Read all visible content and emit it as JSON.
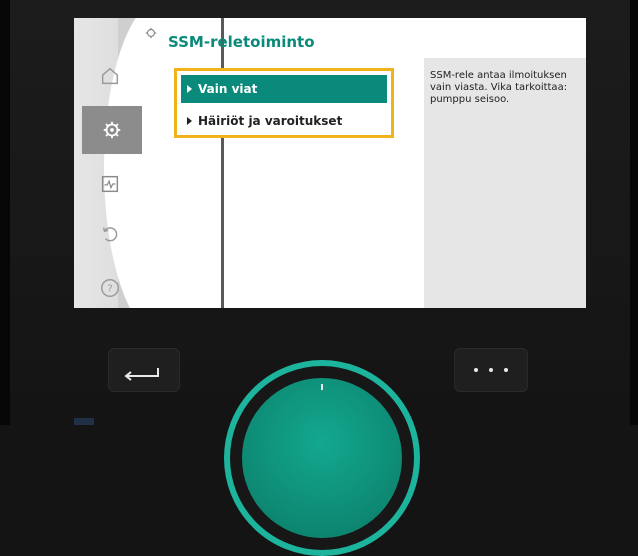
{
  "screen": {
    "title": "SSM-reletoiminto",
    "options": [
      {
        "label": "Vain viat",
        "selected": true
      },
      {
        "label": "Häiriöt ja varoitukset",
        "selected": false
      }
    ],
    "help_text": "SSM-rele antaa ilmoituksen vain viasta. Vika tarkoittaa: pumppu seisoo."
  },
  "sidebar": {
    "items": [
      {
        "icon": "home-icon",
        "active": false
      },
      {
        "icon": "gear-icon",
        "active": true
      },
      {
        "icon": "diagnostics-icon",
        "active": false
      },
      {
        "icon": "restore-icon",
        "active": false
      },
      {
        "icon": "help-icon",
        "active": false
      }
    ]
  },
  "controls": {
    "back_button_icon": "back-arrow-icon",
    "context_button_icon": "more-dots-icon",
    "knob_icon": "operating-knob"
  },
  "colors": {
    "accent": "#0a8a7a",
    "selection_frame": "#f2b21c",
    "knob_ring": "#1db49e"
  }
}
